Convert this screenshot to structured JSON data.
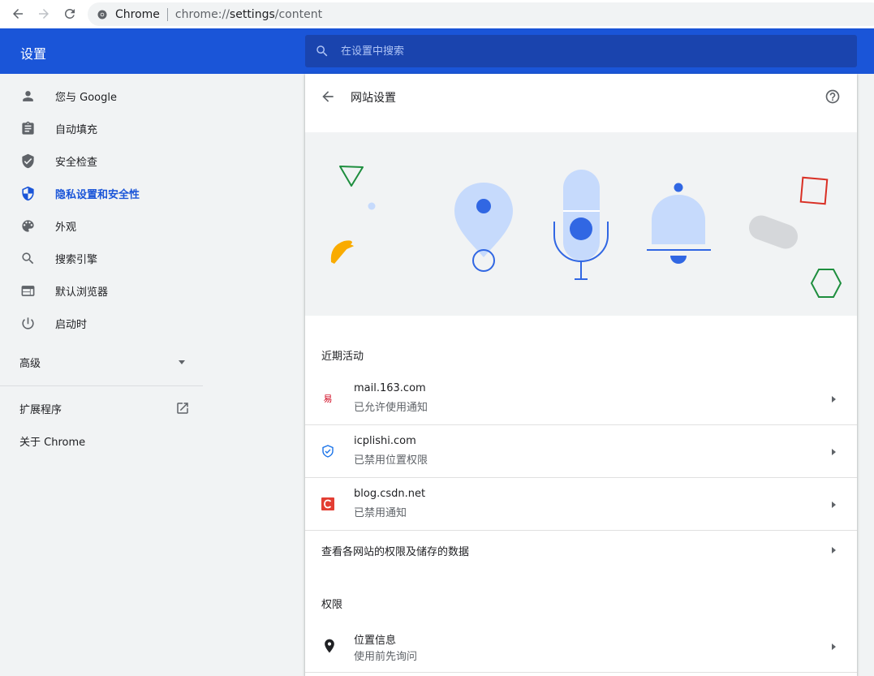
{
  "browser": {
    "back_icon": "arrow-left-icon",
    "forward_icon": "arrow-right-icon",
    "reload_icon": "reload-icon",
    "site_name": "Chrome",
    "url_scheme": "chrome://",
    "url_host": "settings",
    "url_path": "/content"
  },
  "header": {
    "title": "设置",
    "search_placeholder": "在设置中搜索"
  },
  "sidebar": {
    "items": [
      {
        "label": "您与 Google",
        "icon": "person-icon"
      },
      {
        "label": "自动填充",
        "icon": "clipboard-icon"
      },
      {
        "label": "安全检查",
        "icon": "shield-check-icon"
      },
      {
        "label": "隐私设置和安全性",
        "icon": "shield-privacy-icon",
        "active": true
      },
      {
        "label": "外观",
        "icon": "palette-icon"
      },
      {
        "label": "搜索引擎",
        "icon": "search-icon"
      },
      {
        "label": "默认浏览器",
        "icon": "browser-window-icon"
      },
      {
        "label": "启动时",
        "icon": "power-icon"
      }
    ],
    "advanced_label": "高级",
    "extensions_label": "扩展程序",
    "about_label": "关于 Chrome"
  },
  "main": {
    "title": "网站设置",
    "recent_activity_title": "近期活动",
    "recent_sites": [
      {
        "domain": "mail.163.com",
        "status": "已允许使用通知"
      },
      {
        "domain": "icplishi.com",
        "status": "已禁用位置权限"
      },
      {
        "domain": "blog.csdn.net",
        "status": "已禁用通知"
      }
    ],
    "all_sites_label": "查看各网站的权限及储存的数据",
    "permissions_title": "权限",
    "permissions": [
      {
        "title": "位置信息",
        "subtitle": "使用前先询问",
        "icon": "location-pin-icon"
      }
    ]
  },
  "colors": {
    "accent": "#1a55d8",
    "search_bg": "#1a44ae",
    "banner_bg": "#f1f3f4",
    "illustration_blue": "#3167e3",
    "illustration_light": "#c6dafc"
  }
}
